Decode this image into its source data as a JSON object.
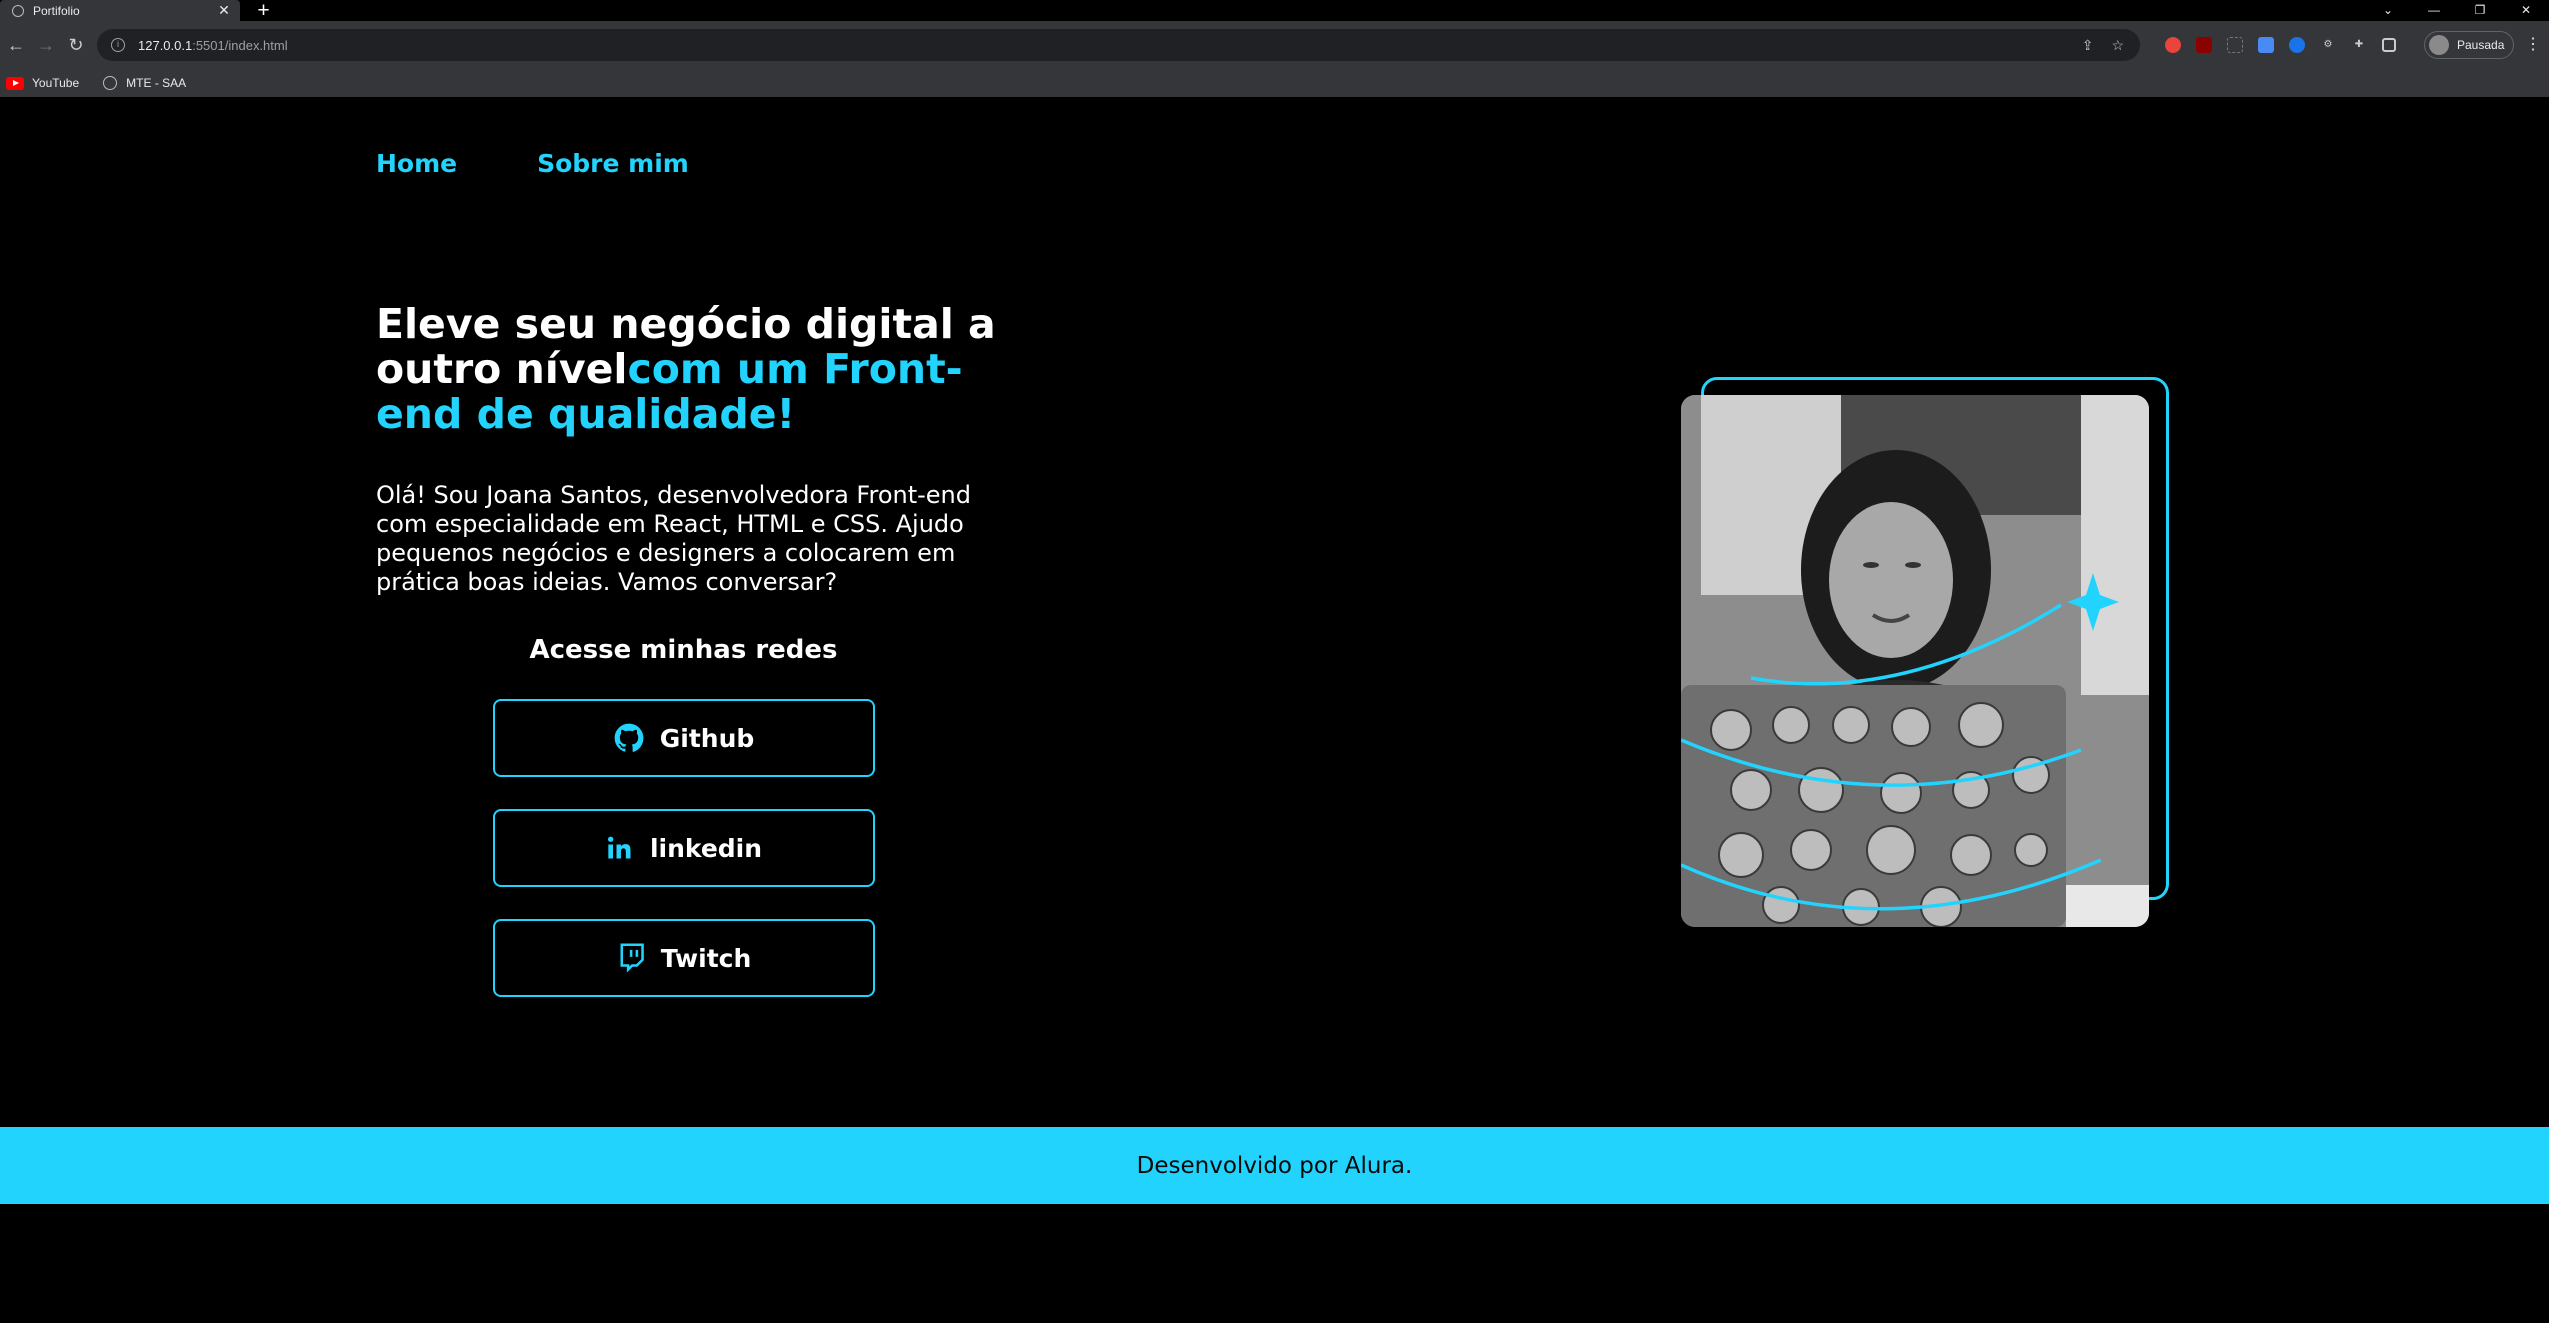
{
  "browser": {
    "tab_title": "Portifolio",
    "url_host": "127.0.0.1",
    "url_path": ":5501/index.html",
    "profile_label": "Pausada",
    "bookmarks": [
      {
        "label": "YouTube",
        "icon": "youtube-icon"
      },
      {
        "label": "MTE - SAA",
        "icon": "globe-icon"
      }
    ]
  },
  "nav": {
    "home": "Home",
    "about": "Sobre mim"
  },
  "hero": {
    "headline_white": "Eleve seu negócio digital a outro nível",
    "headline_accent": "com um Front-end de qualidade!",
    "intro": "Olá! Sou Joana Santos, desenvolvedora Front-end com especialidade em React, HTML e CSS. Ajudo pequenos negócios e designers a colocarem em prática boas ideias. Vamos conversar?"
  },
  "social": {
    "title": "Acesse minhas redes",
    "links": [
      {
        "label": "Github",
        "icon": "github-icon"
      },
      {
        "label": "linkedin",
        "icon": "linkedin-icon"
      },
      {
        "label": "Twitch",
        "icon": "twitch-icon"
      }
    ]
  },
  "footer": {
    "text": "Desenvolvido por Alura."
  },
  "colors": {
    "accent": "#22d4fd",
    "background": "#000000"
  }
}
